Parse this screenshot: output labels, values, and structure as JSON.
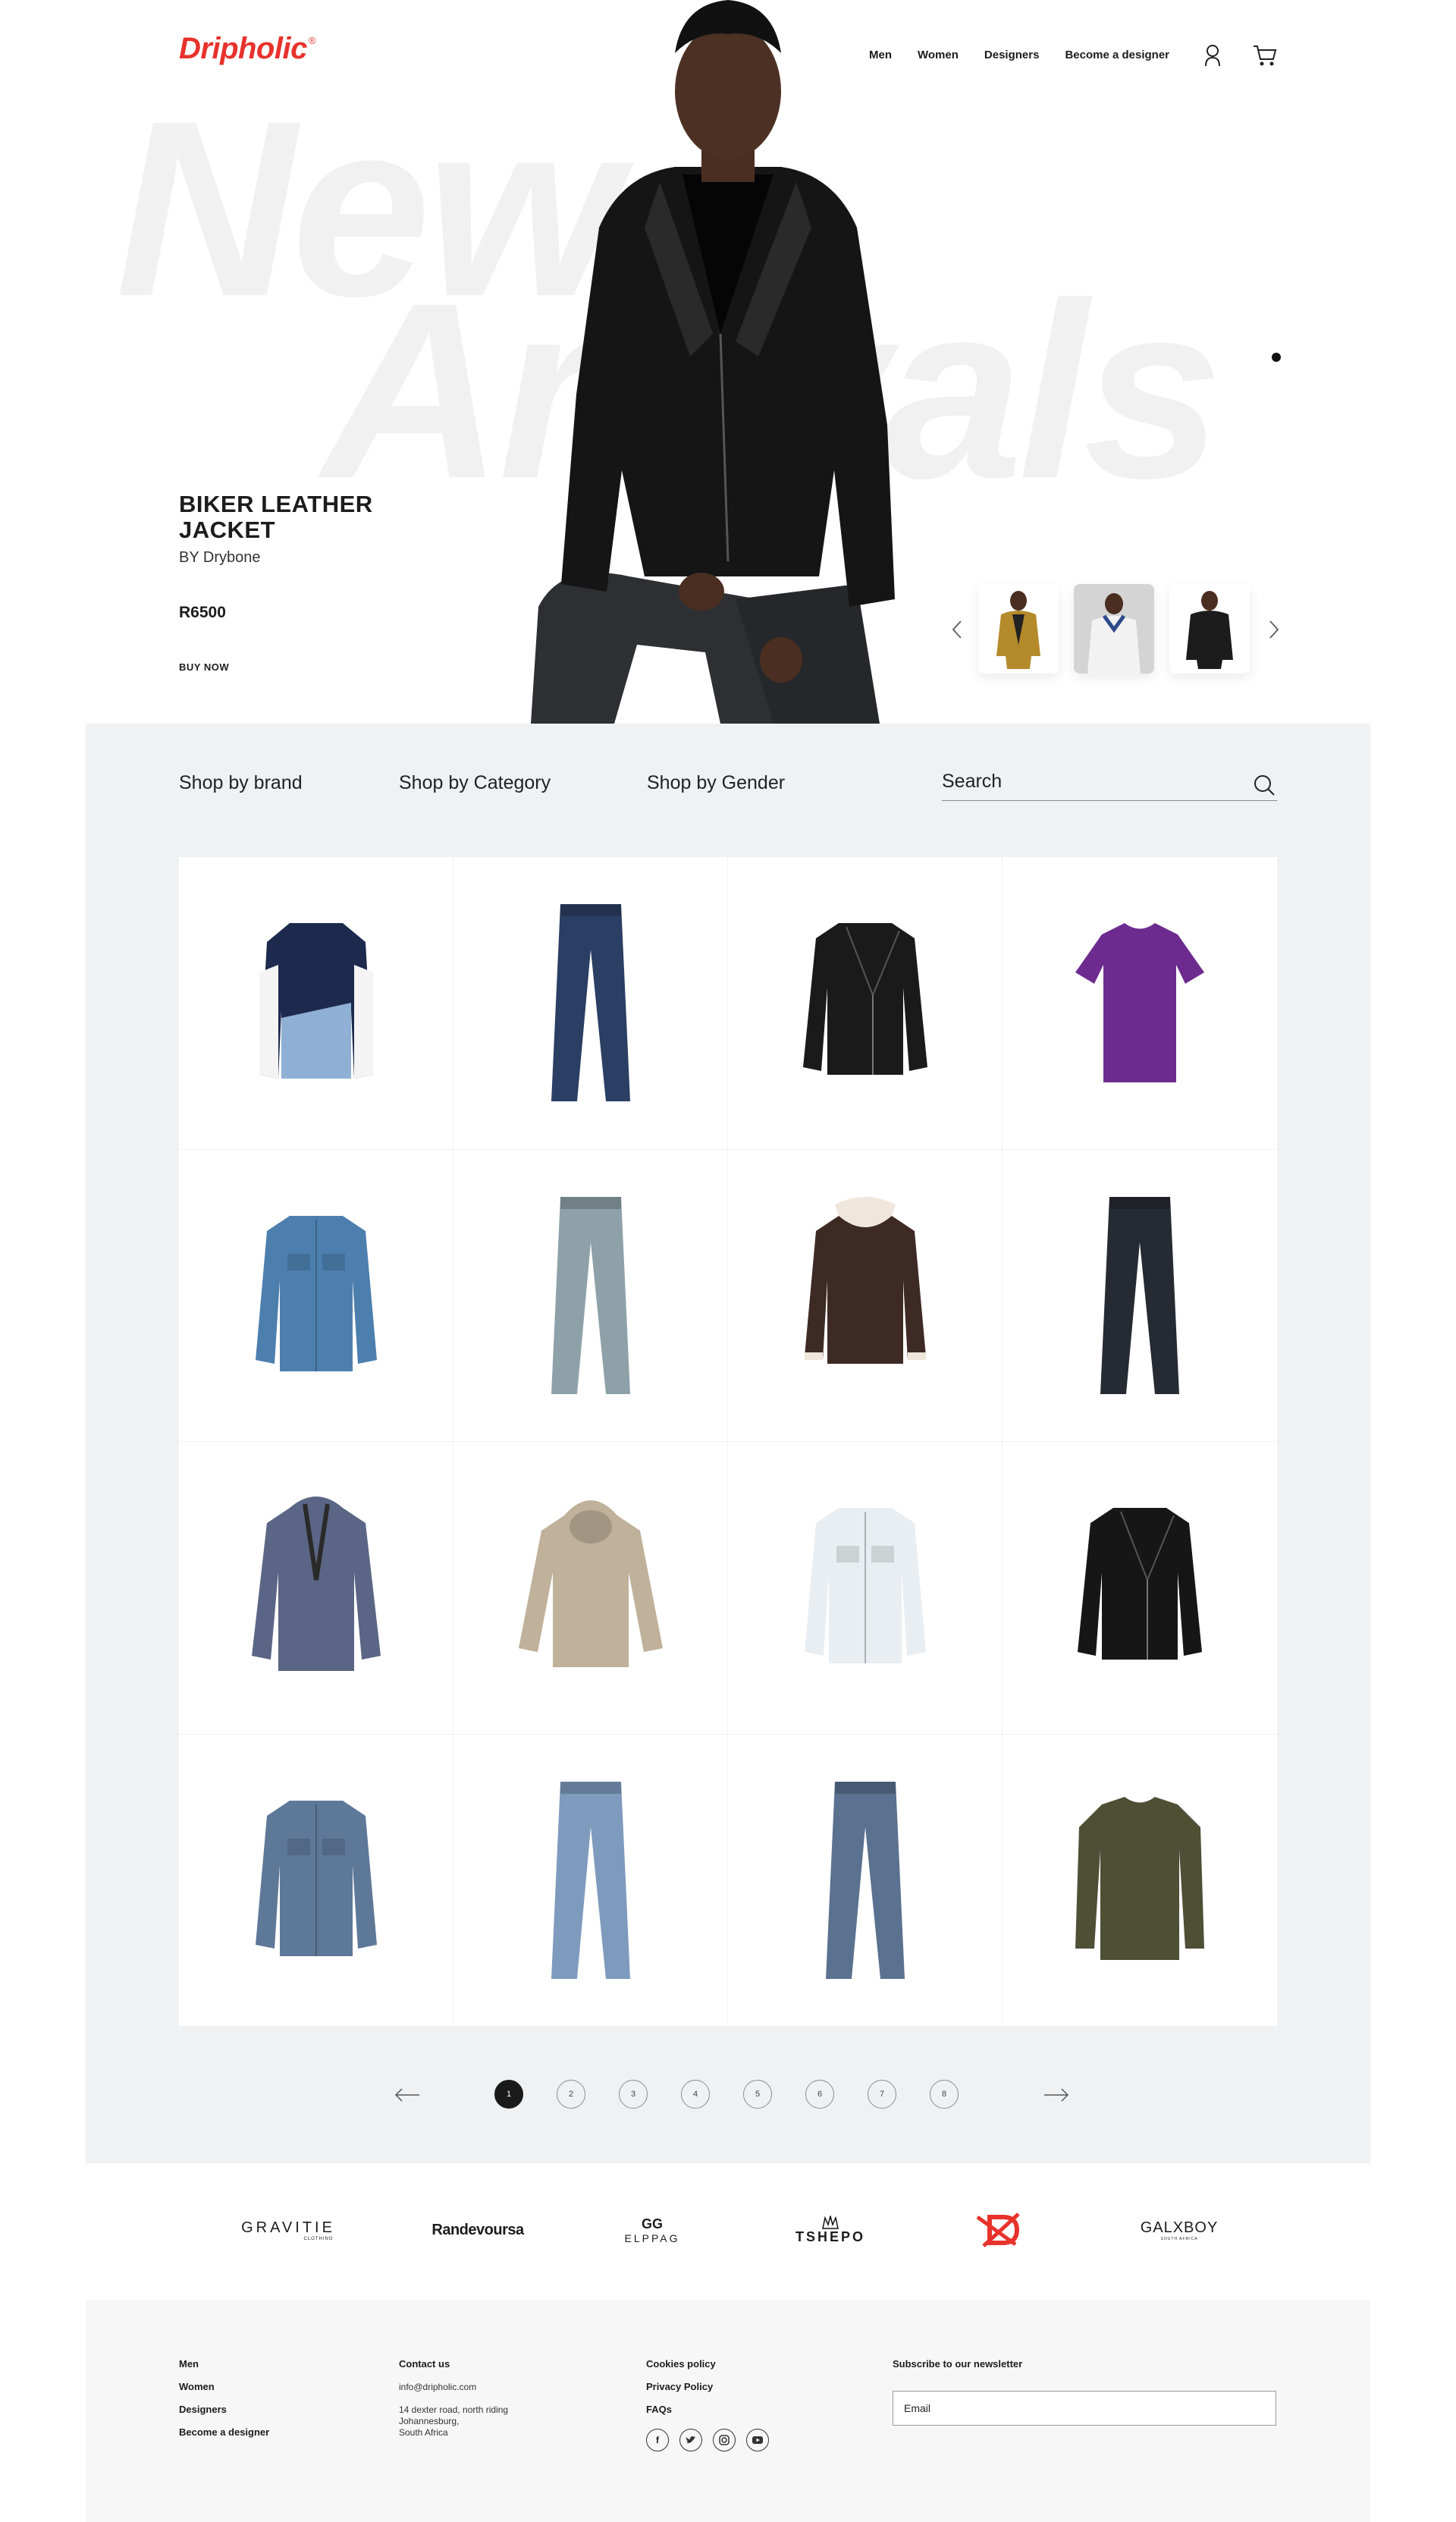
{
  "header": {
    "logo": "Dripholic",
    "logo_mark": "®",
    "nav": [
      "Men",
      "Women",
      "Designers",
      "Become a designer"
    ],
    "user_icon": "user-icon",
    "cart_icon": "cart-icon"
  },
  "hero": {
    "background_word_1": "New",
    "background_word_2": "Arrivals",
    "title": "BIKER LEATHER JACKET",
    "brand": "BY Drybone",
    "price": "R6500",
    "cta": "BUY NOW",
    "slides": 3,
    "active_slide": 2
  },
  "shop": {
    "filters": [
      "Shop by brand",
      "Shop by Category",
      "Shop by Gender"
    ],
    "search_placeholder": "Search",
    "products": [
      {
        "type": "varsity-jacket",
        "color": "#1d2a4d"
      },
      {
        "type": "jeans",
        "color": "#2b3e63"
      },
      {
        "type": "leather-jacket",
        "color": "#1a1a1a"
      },
      {
        "type": "t-shirt",
        "color": "#6d2b8f"
      },
      {
        "type": "denim-jacket",
        "color": "#4c7fae"
      },
      {
        "type": "jeans",
        "color": "#8ea1a8"
      },
      {
        "type": "shearling-jacket",
        "color": "#3e2a24"
      },
      {
        "type": "jeans",
        "color": "#262b33"
      },
      {
        "type": "parka",
        "color": "#5b6585"
      },
      {
        "type": "hoodie",
        "color": "#bfb19a"
      },
      {
        "type": "denim-jacket",
        "color": "#e9eef2"
      },
      {
        "type": "leather-jacket",
        "color": "#161616"
      },
      {
        "type": "denim-jacket",
        "color": "#5e7898"
      },
      {
        "type": "jeans",
        "color": "#7e9bbd"
      },
      {
        "type": "jeans",
        "color": "#5a7190"
      },
      {
        "type": "sweater",
        "color": "#4e4f35"
      }
    ]
  },
  "pagination": {
    "pages": [
      "1",
      "2",
      "3",
      "4",
      "5",
      "6",
      "7",
      "8"
    ],
    "current": "1"
  },
  "brands": [
    "GRAVITIE",
    "CLOTHING",
    "Randevoursa",
    "ELPPAG",
    "TSHEPO",
    "D",
    "GALXBOY",
    "SOUTH AFRICA"
  ],
  "footer": {
    "links": [
      "Men",
      "Women",
      "Designers",
      "Become a designer"
    ],
    "contact_heading": "Contact us",
    "email": "info@dripholic.com",
    "address": [
      "14 dexter road, north riding",
      "Johannesburg,",
      "South Africa"
    ],
    "policies": [
      "Cookies policy",
      "Privacy Policy",
      "FAQs"
    ],
    "social": [
      "facebook-icon",
      "twitter-icon",
      "instagram-icon",
      "youtube-icon"
    ],
    "newsletter_heading": "Subscribe to our newsletter",
    "email_placeholder": "Email"
  },
  "colors": {
    "brand_red": "#e8322c",
    "section_grey": "#f0f1f3",
    "text": "#1c1c1c"
  }
}
